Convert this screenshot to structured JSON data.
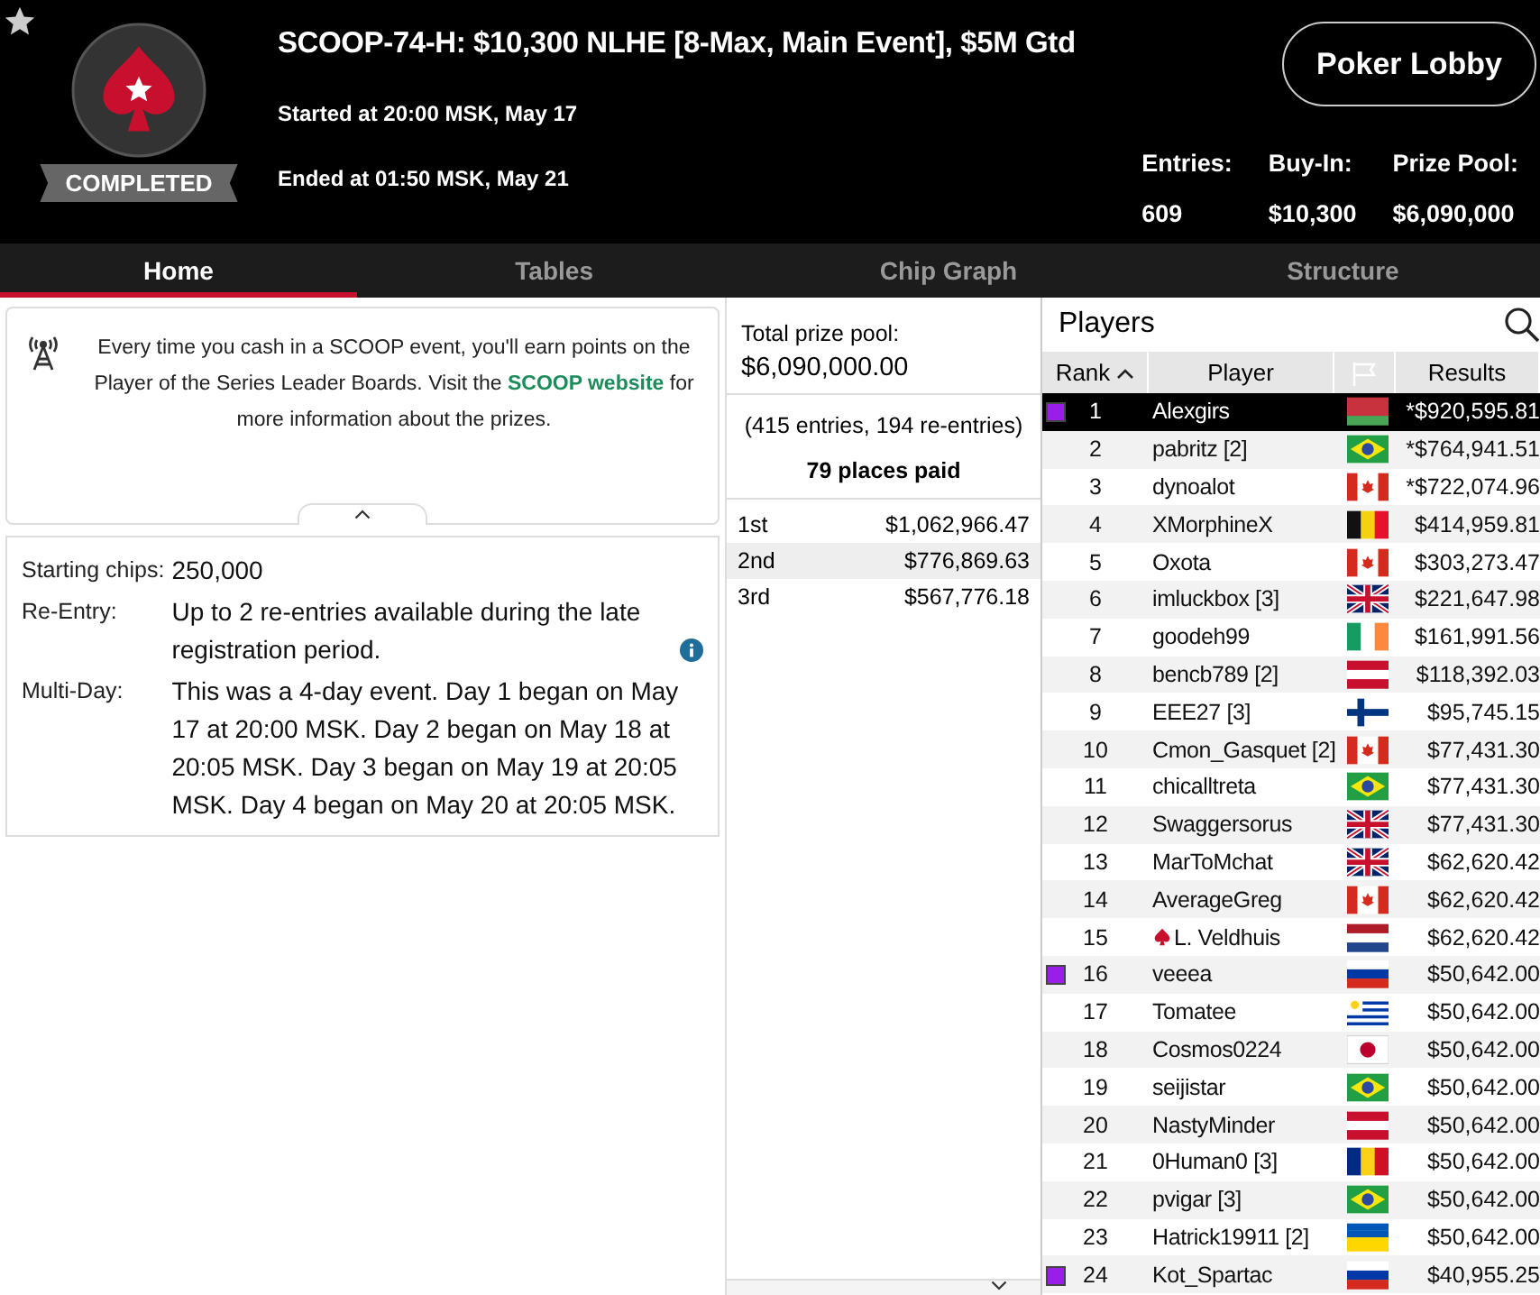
{
  "header": {
    "title": "SCOOP-74-H: $10,300 NLHE [8-Max, Main Event], $5M Gtd",
    "status": "COMPLETED",
    "started": "Started at 20:00 MSK, May 17",
    "ended": "Ended at 01:50 MSK, May 21",
    "lobby_button": "Poker Lobby",
    "stats": [
      {
        "label": "Entries:",
        "value": "609"
      },
      {
        "label": "Buy-In:",
        "value": "$10,300"
      },
      {
        "label": "Prize Pool:",
        "value": "$6,090,000"
      }
    ]
  },
  "tabs": [
    {
      "label": "Home",
      "selected": true
    },
    {
      "label": "Tables",
      "selected": false
    },
    {
      "label": "Chip Graph",
      "selected": false
    },
    {
      "label": "Structure",
      "selected": false
    }
  ],
  "notice": {
    "before": "Every time you cash in a SCOOP event, you'll earn points on the Player of the Series Leader Boards. Visit the",
    "link": "SCOOP website",
    "after": "for more information about the prizes."
  },
  "details": [
    {
      "label": "Starting chips:",
      "value": "250,000",
      "info": false
    },
    {
      "label": "Re-Entry:",
      "value": "Up to 2 re-entries available during the late registration period.",
      "info": true
    },
    {
      "label": "Multi-Day:",
      "value": "This was a 4-day event. Day 1 began on May 17 at 20:00 MSK. Day 2 began on May 18 at 20:05 MSK. Day 3 began on May 19 at 20:05 MSK. Day 4 began on May 20 at 20:05 MSK.",
      "info": false
    }
  ],
  "prizes": {
    "total_label": "Total prize pool:",
    "total": "$6,090,000.00",
    "entries": "(415 entries, 194 re-entries)",
    "places_paid": "79 places paid",
    "places": [
      {
        "place": "1st",
        "amount": "$1,062,966.47"
      },
      {
        "place": "2nd",
        "amount": "$776,869.63"
      },
      {
        "place": "3rd",
        "amount": "$567,776.18"
      }
    ]
  },
  "players": {
    "title": "Players",
    "columns": [
      "Rank",
      "Player",
      "Results"
    ],
    "rows": [
      {
        "rank": "1",
        "name": "Alexgirs",
        "kind": "by",
        "result": "*$920,595.81",
        "selected": true,
        "marked": true,
        "pro": false
      },
      {
        "rank": "2",
        "name": "pabritz [2]",
        "kind": "br",
        "result": "*$764,941.51",
        "selected": false,
        "marked": false,
        "pro": false
      },
      {
        "rank": "3",
        "name": "dynoalot",
        "kind": "ca",
        "result": "*$722,074.96",
        "selected": false,
        "marked": false,
        "pro": false
      },
      {
        "rank": "4",
        "name": "XMorphineX",
        "kind": "be",
        "result": "$414,959.81",
        "selected": false,
        "marked": false,
        "pro": false
      },
      {
        "rank": "5",
        "name": "Oxota",
        "kind": "ca",
        "result": "$303,273.47",
        "selected": false,
        "marked": false,
        "pro": false
      },
      {
        "rank": "6",
        "name": "imluckbox [3]",
        "kind": "gb",
        "result": "$221,647.98",
        "selected": false,
        "marked": false,
        "pro": false
      },
      {
        "rank": "7",
        "name": "goodeh99",
        "kind": "ie",
        "result": "$161,991.56",
        "selected": false,
        "marked": false,
        "pro": false
      },
      {
        "rank": "8",
        "name": "bencb789 [2]",
        "kind": "at",
        "result": "$118,392.03",
        "selected": false,
        "marked": false,
        "pro": false
      },
      {
        "rank": "9",
        "name": "EEE27 [3]",
        "kind": "fi",
        "result": "$95,745.15",
        "selected": false,
        "marked": false,
        "pro": false
      },
      {
        "rank": "10",
        "name": "Cmon_Gasquet [2]",
        "kind": "ca",
        "result": "$77,431.30",
        "selected": false,
        "marked": false,
        "pro": false
      },
      {
        "rank": "11",
        "name": "chicalltreta",
        "kind": "br",
        "result": "$77,431.30",
        "selected": false,
        "marked": false,
        "pro": false
      },
      {
        "rank": "12",
        "name": "Swaggersorus",
        "kind": "gb",
        "result": "$77,431.30",
        "selected": false,
        "marked": false,
        "pro": false
      },
      {
        "rank": "13",
        "name": "MarToMchat",
        "kind": "gb",
        "result": "$62,620.42",
        "selected": false,
        "marked": false,
        "pro": false
      },
      {
        "rank": "14",
        "name": "AverageGreg",
        "kind": "ca",
        "result": "$62,620.42",
        "selected": false,
        "marked": false,
        "pro": false
      },
      {
        "rank": "15",
        "name": "L. Veldhuis",
        "kind": "nl",
        "result": "$62,620.42",
        "selected": false,
        "marked": false,
        "pro": true
      },
      {
        "rank": "16",
        "name": "veeea",
        "kind": "ru",
        "result": "$50,642.00",
        "selected": false,
        "marked": true,
        "pro": false
      },
      {
        "rank": "17",
        "name": "Tomatee",
        "kind": "uy",
        "result": "$50,642.00",
        "selected": false,
        "marked": false,
        "pro": false
      },
      {
        "rank": "18",
        "name": "Cosmos0224",
        "kind": "jp",
        "result": "$50,642.00",
        "selected": false,
        "marked": false,
        "pro": false
      },
      {
        "rank": "19",
        "name": "seijistar",
        "kind": "br",
        "result": "$50,642.00",
        "selected": false,
        "marked": false,
        "pro": false
      },
      {
        "rank": "20",
        "name": "NastyMinder",
        "kind": "at",
        "result": "$50,642.00",
        "selected": false,
        "marked": false,
        "pro": false
      },
      {
        "rank": "21",
        "name": "0Human0 [3]",
        "kind": "ro",
        "result": "$50,642.00",
        "selected": false,
        "marked": false,
        "pro": false
      },
      {
        "rank": "22",
        "name": "pvigar [3]",
        "kind": "br",
        "result": "$50,642.00",
        "selected": false,
        "marked": false,
        "pro": false
      },
      {
        "rank": "23",
        "name": "Hatrick19911 [2]",
        "kind": "ua",
        "result": "$50,642.00",
        "selected": false,
        "marked": false,
        "pro": false
      },
      {
        "rank": "24",
        "name": "Kot_Spartac",
        "kind": "ru",
        "result": "$40,955.25",
        "selected": false,
        "marked": true,
        "pro": false
      }
    ]
  }
}
